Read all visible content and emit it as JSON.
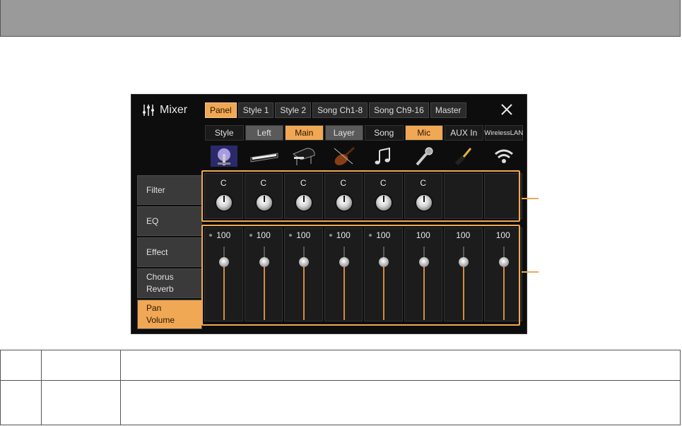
{
  "header": {
    "title": "Mixer"
  },
  "tabs": [
    {
      "label": "Panel",
      "active": true
    },
    {
      "label": "Style 1",
      "active": false
    },
    {
      "label": "Style 2",
      "active": false
    },
    {
      "label": "Song Ch1-8",
      "active": false
    },
    {
      "label": "Song Ch9-16",
      "active": false
    },
    {
      "label": "Master",
      "active": false
    }
  ],
  "parts": [
    {
      "label": "Style",
      "state": "normal",
      "icon": "stage-image-icon"
    },
    {
      "label": "Left",
      "state": "grey",
      "icon": "keyboard-icon"
    },
    {
      "label": "Main",
      "state": "orange",
      "icon": "grand-piano-icon"
    },
    {
      "label": "Layer",
      "state": "grey",
      "icon": "violin-icon"
    },
    {
      "label": "Song",
      "state": "normal",
      "icon": "music-note-icon"
    },
    {
      "label": "Mic",
      "state": "orange",
      "icon": "microphone-icon"
    },
    {
      "label": "AUX In",
      "state": "normal",
      "icon": "audio-jack-icon"
    },
    {
      "label": "WirelessLAN",
      "state": "normal",
      "icon": "wifi-icon"
    }
  ],
  "sidebar": {
    "items": [
      {
        "label": "Filter",
        "active": false
      },
      {
        "label": "EQ",
        "active": false
      },
      {
        "label": "Effect",
        "active": false
      },
      {
        "label": "Chorus\nReverb",
        "active": false
      },
      {
        "label": "Pan\nVolume",
        "active": true
      }
    ]
  },
  "pan": {
    "labels": [
      "C",
      "C",
      "C",
      "C",
      "C",
      "C",
      "",
      ""
    ]
  },
  "volume": {
    "values": [
      "100",
      "100",
      "100",
      "100",
      "100",
      "100",
      "100",
      "100"
    ],
    "has_dot": [
      true,
      true,
      true,
      true,
      true,
      false,
      false,
      false
    ],
    "level_fraction": 0.787
  },
  "colors": {
    "accent": "#f0a855",
    "panel_bg": "#0d0d0d",
    "header_bar": "#9a9a9a"
  }
}
